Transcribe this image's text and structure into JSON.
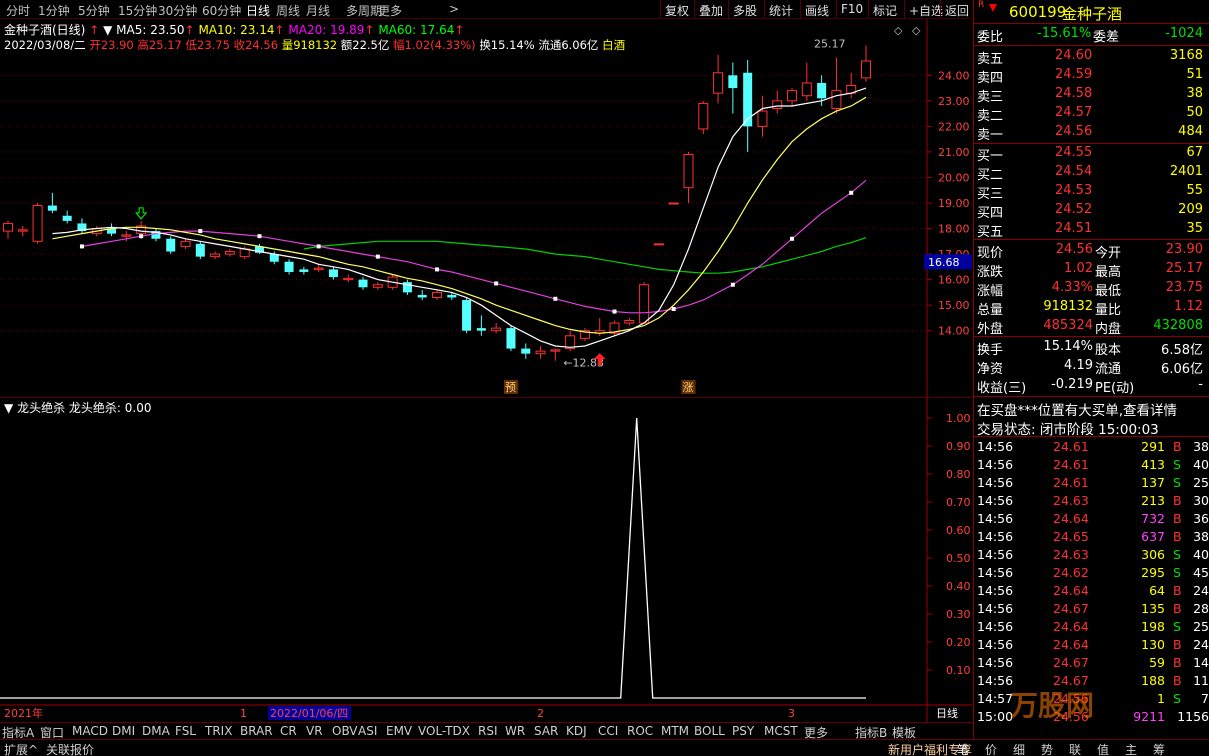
{
  "toolbar": {
    "periods": [
      "分时",
      "1分钟",
      "5分钟",
      "15分钟",
      "30分钟",
      "60分钟",
      "日线",
      "周线",
      "月线",
      "多周期",
      "更多"
    ],
    "active_period": "日线",
    "buttons": [
      "复权",
      "叠加",
      "多股",
      "统计",
      "画线",
      "F10",
      "标记",
      "+自选",
      "返回"
    ]
  },
  "chart": {
    "title": "金种子酒(日线)",
    "ma5_label": "MA5: 23.50",
    "ma10_label": "MA10: 23.14",
    "ma20_label": "MA20: 19.89",
    "ma60_label": "MA60: 17.64",
    "date": "2022/03/08/二",
    "open": "开23.90",
    "high": "高25.17",
    "low": "低23.75",
    "close": "收24.56",
    "volume": "量918132",
    "amount": "额22.5亿",
    "change": "幅1.02(4.33%)",
    "turnover": "换15.14%",
    "float_cap": "流通6.06亿",
    "sector": "白酒",
    "high_mark": "25.17",
    "low_mark": "12.83",
    "marker_yu": "预",
    "marker_zhang": "涨",
    "current_price_tag": "16.68",
    "y_ticks": [
      "24.00",
      "23.00",
      "22.00",
      "21.00",
      "20.00",
      "19.00",
      "18.00",
      "17.00",
      "16.00",
      "15.00",
      "14.00"
    ],
    "x_labels": [
      "2021年",
      "1",
      "2022/01/06/四",
      "2",
      "3",
      "日线"
    ]
  },
  "chart_data": {
    "type": "candlestick",
    "ylim": [
      12.5,
      25.5
    ],
    "candles": [
      {
        "o": 17.9,
        "h": 18.3,
        "l": 17.6,
        "c": 18.2
      },
      {
        "o": 17.9,
        "h": 18.1,
        "l": 17.7,
        "c": 17.95
      },
      {
        "o": 17.5,
        "h": 19.0,
        "l": 17.4,
        "c": 18.9
      },
      {
        "o": 18.9,
        "h": 19.4,
        "l": 18.6,
        "c": 18.7
      },
      {
        "o": 18.5,
        "h": 18.7,
        "l": 18.2,
        "c": 18.3
      },
      {
        "o": 18.2,
        "h": 18.4,
        "l": 17.8,
        "c": 17.9
      },
      {
        "o": 17.8,
        "h": 18.1,
        "l": 17.7,
        "c": 18.0
      },
      {
        "o": 18.0,
        "h": 18.2,
        "l": 17.7,
        "c": 17.8
      },
      {
        "o": 17.7,
        "h": 17.9,
        "l": 17.5,
        "c": 17.75
      },
      {
        "o": 17.8,
        "h": 18.3,
        "l": 17.6,
        "c": 18.1
      },
      {
        "o": 17.9,
        "h": 18.0,
        "l": 17.5,
        "c": 17.6
      },
      {
        "o": 17.6,
        "h": 17.7,
        "l": 17.0,
        "c": 17.1
      },
      {
        "o": 17.3,
        "h": 17.6,
        "l": 17.2,
        "c": 17.5
      },
      {
        "o": 17.4,
        "h": 17.5,
        "l": 16.8,
        "c": 16.9
      },
      {
        "o": 16.9,
        "h": 17.1,
        "l": 16.8,
        "c": 17.0
      },
      {
        "o": 17.0,
        "h": 17.2,
        "l": 16.9,
        "c": 17.1
      },
      {
        "o": 16.9,
        "h": 17.3,
        "l": 16.8,
        "c": 17.2
      },
      {
        "o": 17.3,
        "h": 17.4,
        "l": 17.0,
        "c": 17.05
      },
      {
        "o": 17.0,
        "h": 17.1,
        "l": 16.6,
        "c": 16.7
      },
      {
        "o": 16.7,
        "h": 16.8,
        "l": 16.2,
        "c": 16.3
      },
      {
        "o": 16.4,
        "h": 16.5,
        "l": 16.2,
        "c": 16.3
      },
      {
        "o": 16.4,
        "h": 16.6,
        "l": 16.3,
        "c": 16.45
      },
      {
        "o": 16.4,
        "h": 16.5,
        "l": 16.0,
        "c": 16.1
      },
      {
        "o": 16.0,
        "h": 16.2,
        "l": 15.9,
        "c": 16.05
      },
      {
        "o": 16.0,
        "h": 16.1,
        "l": 15.6,
        "c": 15.7
      },
      {
        "o": 15.7,
        "h": 15.9,
        "l": 15.6,
        "c": 15.8
      },
      {
        "o": 15.7,
        "h": 16.2,
        "l": 15.6,
        "c": 16.1
      },
      {
        "o": 15.9,
        "h": 16.0,
        "l": 15.4,
        "c": 15.5
      },
      {
        "o": 15.4,
        "h": 15.6,
        "l": 15.2,
        "c": 15.3
      },
      {
        "o": 15.3,
        "h": 15.6,
        "l": 15.2,
        "c": 15.5
      },
      {
        "o": 15.4,
        "h": 15.5,
        "l": 15.2,
        "c": 15.3
      },
      {
        "o": 15.2,
        "h": 15.3,
        "l": 13.9,
        "c": 14.0
      },
      {
        "o": 14.1,
        "h": 14.6,
        "l": 13.8,
        "c": 14.0
      },
      {
        "o": 14.0,
        "h": 14.3,
        "l": 13.9,
        "c": 14.1
      },
      {
        "o": 14.1,
        "h": 14.2,
        "l": 13.2,
        "c": 13.3
      },
      {
        "o": 13.3,
        "h": 13.5,
        "l": 12.9,
        "c": 13.1
      },
      {
        "o": 13.1,
        "h": 13.4,
        "l": 12.9,
        "c": 13.2
      },
      {
        "o": 13.2,
        "h": 13.3,
        "l": 12.83,
        "c": 13.25
      },
      {
        "o": 13.3,
        "h": 14.0,
        "l": 13.2,
        "c": 13.8
      },
      {
        "o": 13.7,
        "h": 14.1,
        "l": 13.6,
        "c": 14.0
      },
      {
        "o": 13.9,
        "h": 14.5,
        "l": 13.8,
        "c": 14.0
      },
      {
        "o": 13.9,
        "h": 14.4,
        "l": 13.8,
        "c": 14.3
      },
      {
        "o": 14.3,
        "h": 14.5,
        "l": 14.2,
        "c": 14.4
      },
      {
        "o": 14.3,
        "h": 15.9,
        "l": 14.3,
        "c": 15.8
      },
      {
        "o": 17.4,
        "h": 17.4,
        "l": 17.4,
        "c": 17.4
      },
      {
        "o": 19.0,
        "h": 19.0,
        "l": 19.0,
        "c": 19.0
      },
      {
        "o": 19.6,
        "h": 21.0,
        "l": 19.0,
        "c": 20.9
      },
      {
        "o": 21.9,
        "h": 23.0,
        "l": 21.7,
        "c": 22.9
      },
      {
        "o": 23.3,
        "h": 24.8,
        "l": 22.9,
        "c": 24.1
      },
      {
        "o": 24.0,
        "h": 24.5,
        "l": 22.5,
        "c": 23.5
      },
      {
        "o": 24.1,
        "h": 24.6,
        "l": 21.0,
        "c": 22.0
      },
      {
        "o": 22.0,
        "h": 23.2,
        "l": 21.6,
        "c": 22.6
      },
      {
        "o": 22.7,
        "h": 23.4,
        "l": 22.5,
        "c": 23.0
      },
      {
        "o": 23.0,
        "h": 23.5,
        "l": 22.8,
        "c": 23.4
      },
      {
        "o": 23.2,
        "h": 24.5,
        "l": 23.0,
        "c": 23.7
      },
      {
        "o": 23.7,
        "h": 24.0,
        "l": 22.8,
        "c": 23.1
      },
      {
        "o": 22.7,
        "h": 24.7,
        "l": 22.5,
        "c": 23.4
      },
      {
        "o": 23.3,
        "h": 24.1,
        "l": 23.1,
        "c": 23.6
      },
      {
        "o": 23.9,
        "h": 25.17,
        "l": 23.75,
        "c": 24.56
      }
    ],
    "ma5": [
      17.8,
      17.85,
      17.95,
      18.0,
      18.05,
      18.0,
      17.9,
      17.85,
      17.75,
      17.6,
      17.5,
      17.4,
      17.3,
      17.2,
      17.1,
      17.0,
      16.9,
      16.8,
      16.6,
      16.5,
      16.4,
      16.2,
      16.0,
      15.9,
      15.8,
      15.7,
      15.6,
      15.5,
      15.3,
      15.0,
      14.6,
      14.2,
      13.9,
      13.6,
      13.4,
      13.35,
      13.4,
      13.6,
      13.8,
      14.0,
      14.3,
      14.8,
      15.8,
      17.2,
      18.8,
      20.4,
      21.6,
      22.3,
      22.7,
      22.8,
      22.8,
      22.9,
      23.0,
      23.2,
      23.3,
      23.5
    ],
    "ma10": [
      17.6,
      17.7,
      17.8,
      17.9,
      18.0,
      18.05,
      18.05,
      18.0,
      17.95,
      17.85,
      17.75,
      17.6,
      17.5,
      17.4,
      17.3,
      17.2,
      17.1,
      17.0,
      16.9,
      16.75,
      16.6,
      16.5,
      16.35,
      16.2,
      16.05,
      15.95,
      15.8,
      15.65,
      15.45,
      15.25,
      15.0,
      14.8,
      14.6,
      14.4,
      14.2,
      14.05,
      13.95,
      13.9,
      13.95,
      14.05,
      14.2,
      14.5,
      15.0,
      15.6,
      16.3,
      17.1,
      18.0,
      19.0,
      19.9,
      20.7,
      21.4,
      21.9,
      22.3,
      22.6,
      22.8,
      23.14
    ],
    "ma20": [
      17.3,
      17.4,
      17.5,
      17.6,
      17.7,
      17.8,
      17.85,
      17.9,
      17.9,
      17.85,
      17.8,
      17.75,
      17.7,
      17.6,
      17.5,
      17.4,
      17.3,
      17.2,
      17.1,
      17.0,
      16.9,
      16.8,
      16.7,
      16.55,
      16.4,
      16.3,
      16.15,
      16.0,
      15.85,
      15.7,
      15.55,
      15.4,
      15.25,
      15.1,
      14.95,
      14.85,
      14.75,
      14.7,
      14.7,
      14.75,
      14.85,
      15.0,
      15.2,
      15.5,
      15.8,
      16.2,
      16.6,
      17.1,
      17.6,
      18.1,
      18.6,
      19.0,
      19.4,
      19.89
    ],
    "ma60": [
      17.2,
      17.3,
      17.35,
      17.4,
      17.45,
      17.5,
      17.5,
      17.5,
      17.5,
      17.5,
      17.45,
      17.4,
      17.35,
      17.3,
      17.25,
      17.2,
      17.1,
      17.0,
      16.95,
      16.9,
      16.8,
      16.7,
      16.6,
      16.5,
      16.4,
      16.35,
      16.3,
      16.25,
      16.25,
      16.3,
      16.4,
      16.5,
      16.65,
      16.8,
      16.95,
      17.1,
      17.3,
      17.45,
      17.64
    ],
    "indicator": {
      "name": "龙头绝杀",
      "ylim": [
        0,
        1
      ],
      "spike_index": 37
    }
  },
  "indicator": {
    "title": "龙头绝杀",
    "value_label": "龙头绝杀: 0.00",
    "y_ticks": [
      "1.00",
      "0.90",
      "0.80",
      "0.70",
      "0.60",
      "0.50",
      "0.40",
      "0.30",
      "0.20",
      "0.10"
    ]
  },
  "bottom_tabs": [
    "指标A",
    "窗口",
    "MACD",
    "DMI",
    "DMA",
    "FSL",
    "TRIX",
    "BRAR",
    "CR",
    "VR",
    "OBV",
    "ASI",
    "EMV",
    "VOL-TDX",
    "RSI",
    "WR",
    "SAR",
    "KDJ",
    "CCI",
    "ROC",
    "MTM",
    "BOLL",
    "PSY",
    "MCST",
    "更多",
    "指标B",
    "模板"
  ],
  "status_bar": {
    "left1": "扩展^",
    "left2": "关联报价",
    "right1": "新用户福利专享",
    "right_tabs": [
      "笔",
      "价",
      "细",
      "势",
      "联",
      "值",
      "主",
      "筹"
    ]
  },
  "quote": {
    "code": "600199",
    "name": "金种子酒",
    "flag": "R",
    "weibi_label": "委比",
    "weibi": "-15.61%",
    "weicha_label": "委差",
    "weicha": "-1024",
    "asks": [
      {
        "label": "卖五",
        "price": "24.60",
        "vol": "3168"
      },
      {
        "label": "卖四",
        "price": "24.59",
        "vol": "51"
      },
      {
        "label": "卖三",
        "price": "24.58",
        "vol": "38"
      },
      {
        "label": "卖二",
        "price": "24.57",
        "vol": "50"
      },
      {
        "label": "卖一",
        "price": "24.56",
        "vol": "484"
      }
    ],
    "bids": [
      {
        "label": "买一",
        "price": "24.55",
        "vol": "67"
      },
      {
        "label": "买二",
        "price": "24.54",
        "vol": "2401"
      },
      {
        "label": "买三",
        "price": "24.53",
        "vol": "55"
      },
      {
        "label": "买四",
        "price": "24.52",
        "vol": "209"
      },
      {
        "label": "买五",
        "price": "24.51",
        "vol": "35"
      }
    ],
    "stats": [
      {
        "l1": "现价",
        "v1": "24.56",
        "c1": "red",
        "l2": "今开",
        "v2": "23.90",
        "c2": "red"
      },
      {
        "l1": "涨跌",
        "v1": "1.02",
        "c1": "red",
        "l2": "最高",
        "v2": "25.17",
        "c2": "red"
      },
      {
        "l1": "涨幅",
        "v1": "4.33%",
        "c1": "red",
        "l2": "最低",
        "v2": "23.75",
        "c2": "red"
      },
      {
        "l1": "总量",
        "v1": "918132",
        "c1": "yellow",
        "l2": "量比",
        "v2": "1.12",
        "c2": "red"
      },
      {
        "l1": "外盘",
        "v1": "485324",
        "c1": "red",
        "l2": "内盘",
        "v2": "432808",
        "c2": "green"
      }
    ],
    "stats2": [
      {
        "l1": "换手",
        "v1": "15.14%",
        "l2": "股本",
        "v2": "6.58亿"
      },
      {
        "l1": "净资",
        "v1": "4.19",
        "l2": "流通",
        "v2": "6.06亿"
      },
      {
        "l1": "收益(三)",
        "v1": "-0.219",
        "l2": "PE(动)",
        "v2": "-"
      }
    ],
    "notice1": "在买盘***位置有大买单,查看详情",
    "notice2": "交易状态: 闭市阶段 15:00:03",
    "ticks": [
      {
        "t": "14:56",
        "p": "24.61",
        "v": "291",
        "s": "B",
        "n": "38",
        "vc": "yellow"
      },
      {
        "t": "14:56",
        "p": "24.61",
        "v": "413",
        "s": "S",
        "n": "40",
        "vc": "yellow"
      },
      {
        "t": "14:56",
        "p": "24.61",
        "v": "137",
        "s": "S",
        "n": "25",
        "vc": "yellow"
      },
      {
        "t": "14:56",
        "p": "24.63",
        "v": "213",
        "s": "B",
        "n": "30",
        "vc": "yellow"
      },
      {
        "t": "14:56",
        "p": "24.64",
        "v": "732",
        "s": "B",
        "n": "36",
        "vc": "magenta"
      },
      {
        "t": "14:56",
        "p": "24.65",
        "v": "637",
        "s": "B",
        "n": "38",
        "vc": "magenta"
      },
      {
        "t": "14:56",
        "p": "24.63",
        "v": "306",
        "s": "S",
        "n": "40",
        "vc": "yellow"
      },
      {
        "t": "14:56",
        "p": "24.62",
        "v": "295",
        "s": "S",
        "n": "45",
        "vc": "yellow"
      },
      {
        "t": "14:56",
        "p": "24.64",
        "v": "64",
        "s": "B",
        "n": "24",
        "vc": "yellow"
      },
      {
        "t": "14:56",
        "p": "24.67",
        "v": "135",
        "s": "B",
        "n": "28",
        "vc": "yellow"
      },
      {
        "t": "14:56",
        "p": "24.64",
        "v": "198",
        "s": "S",
        "n": "25",
        "vc": "yellow"
      },
      {
        "t": "14:56",
        "p": "24.64",
        "v": "130",
        "s": "B",
        "n": "24",
        "vc": "yellow"
      },
      {
        "t": "14:56",
        "p": "24.67",
        "v": "59",
        "s": "B",
        "n": "14",
        "vc": "yellow"
      },
      {
        "t": "14:56",
        "p": "24.67",
        "v": "188",
        "s": "B",
        "n": "11",
        "vc": "yellow"
      },
      {
        "t": "14:57",
        "p": "24.56",
        "v": "1",
        "s": "S",
        "n": "7",
        "vc": "yellow"
      },
      {
        "t": "15:00",
        "p": "24.56",
        "v": "9211",
        "s": "",
        "n": "1156",
        "vc": "magenta"
      }
    ],
    "watermark": "万股网"
  }
}
